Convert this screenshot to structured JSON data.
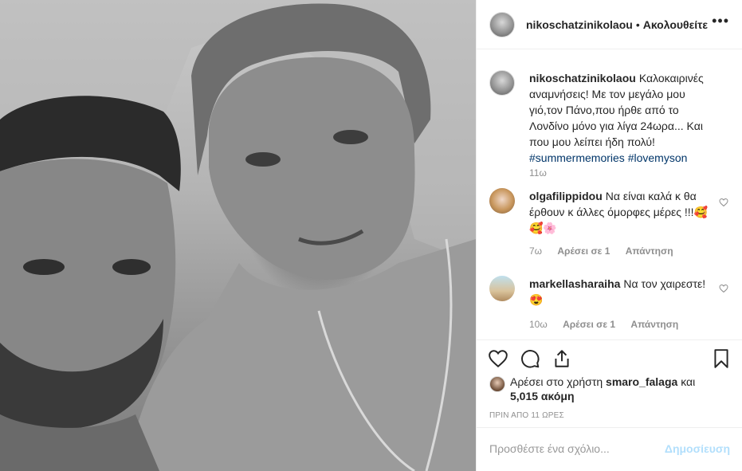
{
  "header": {
    "username": "nikoschatzinikolaou",
    "separator": "•",
    "follow_label": "Ακολουθείτε",
    "more_icon": "more-horizontal-icon"
  },
  "caption": {
    "username": "nikoschatzinikolaou",
    "text": "Καλοκαιρινές αναμνήσεις! Με τον μεγάλο μου γιό,τον Πάνο,που ήρθε από το Λονδίνο μόνο για λίγα 24ωρα... Και που μου λείπει ήδη πολύ!",
    "hashtag1": "#summermemories",
    "hashtag2": "#lovemyson",
    "time": "11ω"
  },
  "comments": [
    {
      "username": "olgafilippidou",
      "text": "Να είναι καλά κ θα έρθουν κ άλλες όμορφες μέρες !!!🥰🥰🌸",
      "time": "7ω",
      "likes": "Αρέσει σε 1",
      "reply": "Απάντηση"
    },
    {
      "username": "markellasharaiha",
      "text": "Να τον χαιρεστε!😍",
      "time": "10ω",
      "likes": "Αρέσει σε 1",
      "reply": "Απάντηση"
    }
  ],
  "actions": {
    "like_icon": "heart-icon",
    "comment_icon": "comment-icon",
    "share_icon": "share-icon",
    "save_icon": "bookmark-icon"
  },
  "likes": {
    "prefix": "Αρέσει στο χρήστη",
    "user": "smaro_falaga",
    "conj": "και",
    "count": "5,015 ακόμη"
  },
  "timestamp": "ΠΡΙΝ ΑΠΟ 11 ΩΡΕΣ",
  "add_comment": {
    "placeholder": "Προσθέστε ένα σχόλιο...",
    "post_label": "Δημοσίευση"
  }
}
